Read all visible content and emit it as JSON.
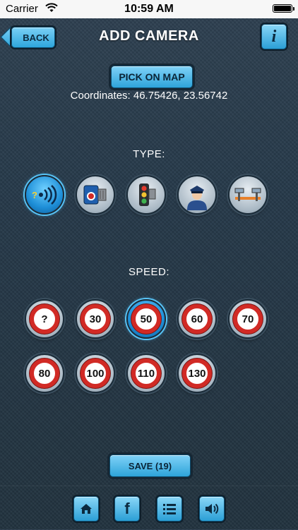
{
  "status_bar": {
    "carrier": "Carrier",
    "time": "10:59 AM"
  },
  "nav": {
    "back_label": "BACK",
    "title": "ADD CAMERA",
    "info_label": "i"
  },
  "pick_on_map_label": "PICK ON MAP",
  "coordinates_text": "Coordinates: 46.75426, 23.56742",
  "type_label": "TYPE:",
  "types": [
    {
      "icon": "unknown-camera-icon",
      "selected": true
    },
    {
      "icon": "speed-camera-icon",
      "selected": false
    },
    {
      "icon": "traffic-light-icon",
      "selected": false
    },
    {
      "icon": "police-icon",
      "selected": false
    },
    {
      "icon": "average-speed-camera-icon",
      "selected": false
    }
  ],
  "speed_label": "SPEED:",
  "speeds": [
    {
      "label": "?",
      "selected": false
    },
    {
      "label": "30",
      "selected": false
    },
    {
      "label": "50",
      "selected": true
    },
    {
      "label": "60",
      "selected": false
    },
    {
      "label": "70",
      "selected": false
    },
    {
      "label": "80",
      "selected": false
    },
    {
      "label": "100",
      "selected": false
    },
    {
      "label": "110",
      "selected": false
    },
    {
      "label": "130",
      "selected": false
    }
  ],
  "save_label": "SAVE (19)",
  "bottom_nav": [
    "home-icon",
    "facebook-icon",
    "list-icon",
    "speaker-icon"
  ],
  "facebook_glyph": "f",
  "colors": {
    "accent": "#2ea4da",
    "speed_sign_red": "#d12a25",
    "selected_glow": "#58c3f5"
  }
}
